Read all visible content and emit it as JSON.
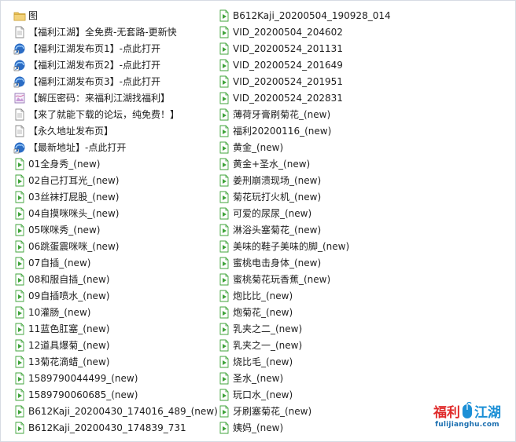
{
  "colors": {
    "folder": "#e9c25a",
    "video_green": "#3fa33a",
    "shortcut_blue": "#2b6cc4",
    "watermark_red": "#e02b2b",
    "watermark_blue": "#1b8fd6"
  },
  "columns": [
    [
      {
        "name": "图",
        "icon": "folder-icon"
      },
      {
        "name": "【福利江湖】全免费-无套路-更新快",
        "icon": "text-file-icon"
      },
      {
        "name": "【福利江湖发布页1】-点此打开",
        "icon": "shortcut-icon"
      },
      {
        "name": "【福利江湖发布页2】-点此打开",
        "icon": "shortcut-icon"
      },
      {
        "name": "【福利江湖发布页3】-点此打开",
        "icon": "shortcut-icon"
      },
      {
        "name": "【解压密码：来福利江湖找福利】",
        "icon": "image-file-icon"
      },
      {
        "name": "【来了就能下载的论坛，纯免费！】",
        "icon": "text-file-icon"
      },
      {
        "name": "【永久地址发布页】",
        "icon": "text-file-icon"
      },
      {
        "name": "【最新地址】-点此打开",
        "icon": "shortcut-icon"
      },
      {
        "name": "01全身秀_(new)",
        "icon": "video-file-icon"
      },
      {
        "name": "02自己打耳光_(new)",
        "icon": "video-file-icon"
      },
      {
        "name": "03丝袜打屁股_(new)",
        "icon": "video-file-icon"
      },
      {
        "name": "04自摸咪咪头_(new)",
        "icon": "video-file-icon"
      },
      {
        "name": "05咪咪秀_(new)",
        "icon": "video-file-icon"
      },
      {
        "name": "06跳蛋震咪咪_(new)",
        "icon": "video-file-icon"
      },
      {
        "name": "07自插_(new)",
        "icon": "video-file-icon"
      },
      {
        "name": "08和服自插_(new)",
        "icon": "video-file-icon"
      },
      {
        "name": "09自插喷水_(new)",
        "icon": "video-file-icon"
      },
      {
        "name": "10灌肠_(new)",
        "icon": "video-file-icon"
      },
      {
        "name": "11蓝色肛塞_(new)",
        "icon": "video-file-icon"
      },
      {
        "name": "12道具爆菊_(new)",
        "icon": "video-file-icon"
      },
      {
        "name": "13菊花滴蜡_(new)",
        "icon": "video-file-icon"
      },
      {
        "name": "1589790044499_(new)",
        "icon": "video-file-icon"
      },
      {
        "name": "1589790060685_(new)",
        "icon": "video-file-icon"
      },
      {
        "name": "B612Kaji_20200430_174016_489_(new)",
        "icon": "video-file-icon"
      },
      {
        "name": "B612Kaji_20200430_174839_731",
        "icon": "video-file-icon"
      }
    ],
    [
      {
        "name": "B612Kaji_20200504_190928_014",
        "icon": "video-file-icon"
      },
      {
        "name": "VID_20200504_204602",
        "icon": "video-file-icon"
      },
      {
        "name": "VID_20200524_201131",
        "icon": "video-file-icon"
      },
      {
        "name": "VID_20200524_201649",
        "icon": "video-file-icon"
      },
      {
        "name": "VID_20200524_201951",
        "icon": "video-file-icon"
      },
      {
        "name": "VID_20200524_202831",
        "icon": "video-file-icon"
      },
      {
        "name": "薄荷牙膏刷菊花_(new)",
        "icon": "video-file-icon"
      },
      {
        "name": "福利20200116_(new)",
        "icon": "video-file-icon"
      },
      {
        "name": "黄金_(new)",
        "icon": "video-file-icon"
      },
      {
        "name": "黄金+圣水_(new)",
        "icon": "video-file-icon"
      },
      {
        "name": "姜刑崩溃现场_(new)",
        "icon": "video-file-icon"
      },
      {
        "name": "菊花玩打火机_(new)",
        "icon": "video-file-icon"
      },
      {
        "name": "可爱的尿尿_(new)",
        "icon": "video-file-icon"
      },
      {
        "name": "淋浴头塞菊花_(new)",
        "icon": "video-file-icon"
      },
      {
        "name": "美味的鞋子美味的脚_(new)",
        "icon": "video-file-icon"
      },
      {
        "name": "蜜桃电击身体_(new)",
        "icon": "video-file-icon"
      },
      {
        "name": "蜜桃菊花玩香蕉_(new)",
        "icon": "video-file-icon"
      },
      {
        "name": "炮比比_(new)",
        "icon": "video-file-icon"
      },
      {
        "name": "炮菊花_(new)",
        "icon": "video-file-icon"
      },
      {
        "name": "乳夹之二_(new)",
        "icon": "video-file-icon"
      },
      {
        "name": "乳夹之一_(new)",
        "icon": "video-file-icon"
      },
      {
        "name": "烧比毛_(new)",
        "icon": "video-file-icon"
      },
      {
        "name": "圣水_(new)",
        "icon": "video-file-icon"
      },
      {
        "name": "玩口水_(new)",
        "icon": "video-file-icon"
      },
      {
        "name": "牙刷塞菊花_(new)",
        "icon": "video-file-icon"
      },
      {
        "name": "姨妈_(new)",
        "icon": "video-file-icon"
      }
    ]
  ],
  "watermark": {
    "brand_left": "福利",
    "brand_right": "江湖",
    "url": "fulijianghu.com"
  }
}
